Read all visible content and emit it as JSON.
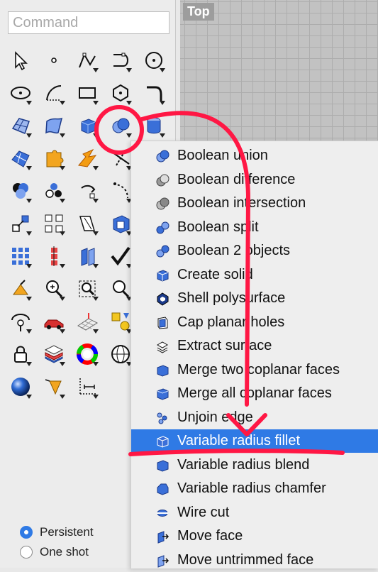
{
  "command": {
    "placeholder": "Command"
  },
  "viewport": {
    "label": "Top"
  },
  "tools": [
    "arrow-select",
    "point",
    "polyline",
    "curve",
    "circle",
    "ellipse",
    "arc",
    "rectangle",
    "polygon",
    "fillet-curve",
    "surface-from-points",
    "loft-surface",
    "box-solid",
    "boolean-union-tool",
    "cylinder",
    "surface-network",
    "puzzle-join",
    "explode",
    "trim",
    "split",
    "group-circles",
    "group-objects",
    "rotate",
    "array-curve",
    "extract",
    "transform-scale",
    "layout-grid",
    "mirror-flat",
    "box-solid-highlight",
    "check",
    "grid-array",
    "align",
    "flat-panels",
    "check-mark",
    "crop",
    "gumball",
    "zoom-plus",
    "zoom-window",
    "zoom-extents",
    "zoom-selected",
    "rotate-view",
    "car",
    "perspective-grid",
    "shapes",
    "layers",
    "lock",
    "layer-material",
    "color-wheel",
    "wire-sphere",
    "display",
    "render-sphere",
    "light",
    "dimension",
    "props",
    "blank"
  ],
  "menu": {
    "items": [
      {
        "label": "Boolean union",
        "icon": "boolean-union-icon"
      },
      {
        "label": "Boolean difference",
        "icon": "boolean-difference-icon"
      },
      {
        "label": "Boolean intersection",
        "icon": "boolean-intersection-icon"
      },
      {
        "label": "Boolean split",
        "icon": "boolean-split-icon"
      },
      {
        "label": "Boolean 2 objects",
        "icon": "boolean-2-objects-icon"
      },
      {
        "label": "Create solid",
        "icon": "create-solid-icon"
      },
      {
        "label": "Shell polysurface",
        "icon": "shell-polysurface-icon"
      },
      {
        "label": "Cap planar holes",
        "icon": "cap-planar-holes-icon"
      },
      {
        "label": "Extract surface",
        "icon": "extract-surface-icon"
      },
      {
        "label": "Merge two coplanar faces",
        "icon": "merge-two-faces-icon"
      },
      {
        "label": "Merge all coplanar faces",
        "icon": "merge-all-faces-icon"
      },
      {
        "label": "Unjoin edge",
        "icon": "unjoin-edge-icon"
      },
      {
        "label": "Variable radius fillet",
        "icon": "variable-radius-fillet-icon"
      },
      {
        "label": "Variable radius blend",
        "icon": "variable-radius-blend-icon"
      },
      {
        "label": "Variable radius chamfer",
        "icon": "variable-radius-chamfer-icon"
      },
      {
        "label": "Wire cut",
        "icon": "wire-cut-icon"
      },
      {
        "label": "Move face",
        "icon": "move-face-icon"
      },
      {
        "label": "Move untrimmed face",
        "icon": "move-untrimmed-face-icon"
      }
    ],
    "selected_index": 12
  },
  "options": {
    "persistent": "Persistent",
    "one_shot": "One shot",
    "selected": "persistent"
  },
  "colors": {
    "accent": "#2f7ae5",
    "annotation": "#ff1744",
    "icon_blue": "#3a6fd8"
  }
}
